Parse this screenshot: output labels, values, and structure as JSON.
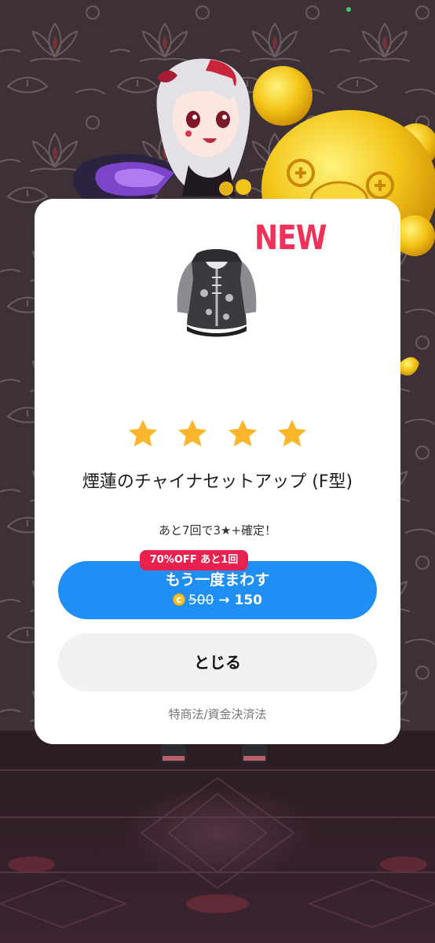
{
  "gacha_result": {
    "new_badge": "NEW",
    "rarity_stars": 4,
    "item_name": "煙蓮のチャイナセットアップ (F型)",
    "guarantee_text": "あと7回で3★+確定！",
    "discount_badge": "70%OFF あと1回",
    "spin_again_label": "もう一度まわす",
    "price": {
      "currency_icon": "coin-icon",
      "original": "500",
      "arrow": "→",
      "discounted": "150"
    },
    "close_label": "とじる",
    "legal_link": "特商法/資金決済法"
  },
  "colors": {
    "new_badge": "#f0325a",
    "star": "#fbb62b",
    "primary_button": "#1f8ff5",
    "discount_badge": "#e8214f",
    "close_button": "#f1f1f1"
  }
}
